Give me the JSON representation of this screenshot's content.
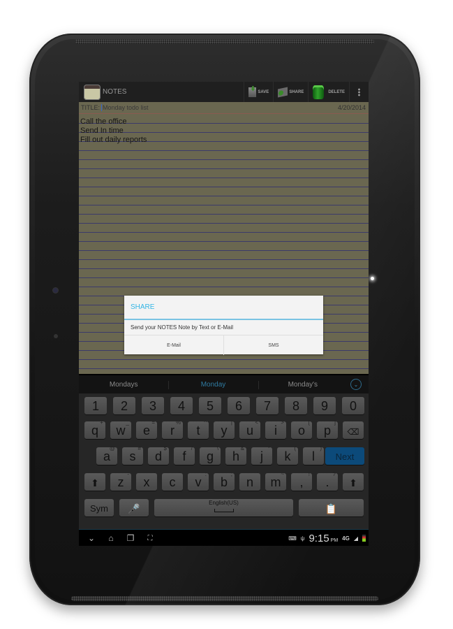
{
  "app": {
    "title": "NOTES"
  },
  "actionbar": {
    "save_label": "SAVE",
    "share_label": "SHARE",
    "delete_label": "DELETE",
    "overflow_icon": "more-vert-icon"
  },
  "note": {
    "title_label": "TITLE:",
    "title_value": "Monday todo list",
    "date": "4/20/2014",
    "lines": [
      "Call the office",
      "Send In time",
      "Fill out daily reports"
    ]
  },
  "dialog": {
    "title": "SHARE",
    "message": "Send your NOTES Note by Text or E-Mail",
    "buttons": [
      "E-Mail",
      "SMS"
    ],
    "accent": "#33b5e5"
  },
  "suggestions": {
    "items": [
      "Mondays",
      "Monday",
      "Monday's"
    ],
    "selected_index": 1
  },
  "keyboard": {
    "row_numbers": [
      "1",
      "2",
      "3",
      "4",
      "5",
      "6",
      "7",
      "8",
      "9",
      "0"
    ],
    "row_qwerty": [
      {
        "k": "q",
        "h": "+"
      },
      {
        "k": "w",
        "h": "_"
      },
      {
        "k": "e",
        "h": "="
      },
      {
        "k": "r",
        "h": "%"
      },
      {
        "k": "t",
        "h": "^"
      },
      {
        "k": "y",
        "h": "|"
      },
      {
        "k": "u",
        "h": "<"
      },
      {
        "k": "i",
        "h": ">"
      },
      {
        "k": "o",
        "h": "["
      },
      {
        "k": "p",
        "h": "]"
      }
    ],
    "row_asdf": [
      {
        "k": "a",
        "h": "@"
      },
      {
        "k": "s",
        "h": "#"
      },
      {
        "k": "d",
        "h": "$"
      },
      {
        "k": "f",
        "h": "/"
      },
      {
        "k": "g",
        "h": "\\"
      },
      {
        "k": "h",
        "h": "&"
      },
      {
        "k": "j",
        "h": "*"
      },
      {
        "k": "k",
        "h": "("
      },
      {
        "k": "l",
        "h": ")"
      }
    ],
    "row_zxcv": [
      {
        "k": "z",
        "h": "-"
      },
      {
        "k": "x",
        "h": "'"
      },
      {
        "k": "c",
        "h": "\""
      },
      {
        "k": "v",
        "h": ":"
      },
      {
        "k": "b",
        "h": ";"
      },
      {
        "k": "n",
        "h": "`"
      },
      {
        "k": "m",
        "h": "~"
      },
      {
        "k": ",",
        "h": "!"
      },
      {
        "k": ".",
        "h": "?"
      }
    ],
    "next_label": "Next",
    "sym_label": "Sym",
    "space_label": "English(US)",
    "next_color": "#0c4a7a"
  },
  "statusbar": {
    "time": "9:15",
    "ampm": "PM",
    "network": "4G"
  }
}
